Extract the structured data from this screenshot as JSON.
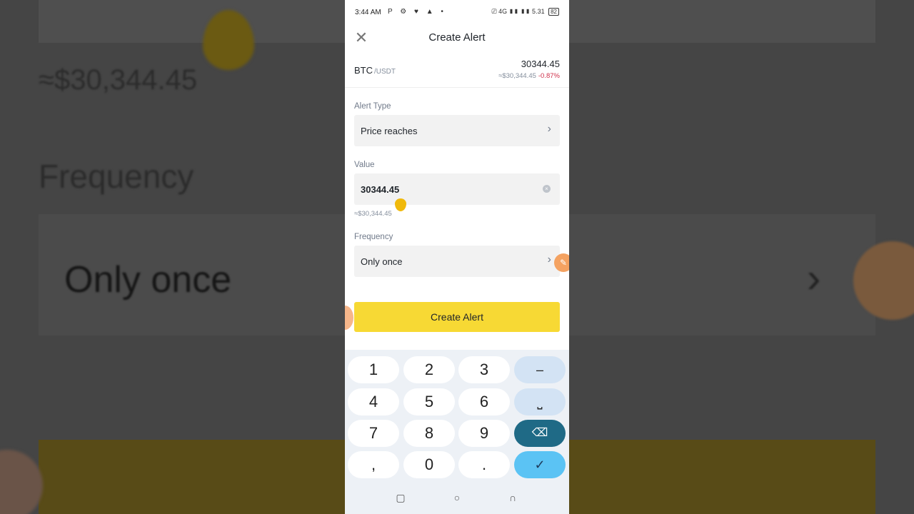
{
  "background": {
    "price": "≈$30,344.45",
    "frequency_label": "Frequency",
    "frequency_value": "Only once",
    "chevron": "›"
  },
  "status_bar": {
    "time": "3:44 AM",
    "left_icons": "P ⚙ ♥ ▲ •",
    "right_icons": "⎚ 4G ▮▮ ▮▮ 5.31",
    "battery": "82"
  },
  "header": {
    "close_icon": "✕",
    "title": "Create Alert"
  },
  "pair": {
    "base": "BTC",
    "quote": "/USDT",
    "price": "30344.45",
    "usd_price": "≈$30,344.45",
    "change": "-0.87%"
  },
  "alert_type": {
    "label": "Alert Type",
    "value": "Price reaches",
    "chevron": "›"
  },
  "value_field": {
    "label": "Value",
    "value": "30344.45",
    "clear_icon": "×",
    "hint": "≈$30,344.45"
  },
  "frequency": {
    "label": "Frequency",
    "value": "Only once",
    "chevron": "›"
  },
  "create_button": "Create Alert",
  "keyboard": {
    "rows": [
      [
        "1",
        "2",
        "3",
        "–"
      ],
      [
        "4",
        "5",
        "6",
        "⎵"
      ],
      [
        "7",
        "8",
        "9",
        "⌫"
      ],
      [
        ",",
        "0",
        ".",
        "✓"
      ]
    ]
  },
  "navbar": {
    "recent": "▢",
    "home": "○",
    "back": "∩"
  },
  "colors": {
    "accent": "#f7d934",
    "negative": "#cf304a",
    "keyboard_bg": "#edf1f6"
  }
}
